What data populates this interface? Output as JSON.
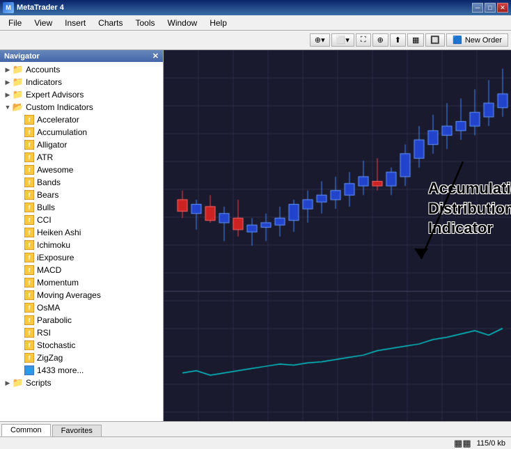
{
  "titleBar": {
    "title": "MetaTrader 4",
    "minimizeLabel": "─",
    "maximizeLabel": "□",
    "closeLabel": "✕"
  },
  "menuBar": {
    "items": [
      "File",
      "View",
      "Insert",
      "Charts",
      "Tools",
      "Window",
      "Help"
    ]
  },
  "toolbar": {
    "newOrderLabel": "New Order"
  },
  "navigator": {
    "title": "Navigator",
    "closeLabel": "✕",
    "tree": [
      {
        "id": "accounts",
        "label": "Accounts",
        "indent": 0,
        "type": "root",
        "expanded": false
      },
      {
        "id": "indicators",
        "label": "Indicators",
        "indent": 0,
        "type": "root",
        "expanded": false
      },
      {
        "id": "expert-advisors",
        "label": "Expert Advisors",
        "indent": 0,
        "type": "root",
        "expanded": false
      },
      {
        "id": "custom-indicators",
        "label": "Custom Indicators",
        "indent": 0,
        "type": "root-open",
        "expanded": true
      },
      {
        "id": "accelerator",
        "label": "Accelerator",
        "indent": 1,
        "type": "indicator"
      },
      {
        "id": "accumulation",
        "label": "Accumulation",
        "indent": 1,
        "type": "indicator"
      },
      {
        "id": "alligator",
        "label": "Alligator",
        "indent": 1,
        "type": "indicator"
      },
      {
        "id": "atr",
        "label": "ATR",
        "indent": 1,
        "type": "indicator"
      },
      {
        "id": "awesome",
        "label": "Awesome",
        "indent": 1,
        "type": "indicator"
      },
      {
        "id": "bands",
        "label": "Bands",
        "indent": 1,
        "type": "indicator"
      },
      {
        "id": "bears",
        "label": "Bears",
        "indent": 1,
        "type": "indicator"
      },
      {
        "id": "bulls",
        "label": "Bulls",
        "indent": 1,
        "type": "indicator"
      },
      {
        "id": "cci",
        "label": "CCI",
        "indent": 1,
        "type": "indicator"
      },
      {
        "id": "heiken-ashi",
        "label": "Heiken Ashi",
        "indent": 1,
        "type": "indicator"
      },
      {
        "id": "ichimoku",
        "label": "Ichimoku",
        "indent": 1,
        "type": "indicator"
      },
      {
        "id": "iexposure",
        "label": "iExposure",
        "indent": 1,
        "type": "indicator"
      },
      {
        "id": "macd",
        "label": "MACD",
        "indent": 1,
        "type": "indicator"
      },
      {
        "id": "momentum",
        "label": "Momentum",
        "indent": 1,
        "type": "indicator"
      },
      {
        "id": "moving-averages",
        "label": "Moving Averages",
        "indent": 1,
        "type": "indicator"
      },
      {
        "id": "osma",
        "label": "OsMA",
        "indent": 1,
        "type": "indicator"
      },
      {
        "id": "parabolic",
        "label": "Parabolic",
        "indent": 1,
        "type": "indicator"
      },
      {
        "id": "rsi",
        "label": "RSI",
        "indent": 1,
        "type": "indicator"
      },
      {
        "id": "stochastic",
        "label": "Stochastic",
        "indent": 1,
        "type": "indicator"
      },
      {
        "id": "zigzag",
        "label": "ZigZag",
        "indent": 1,
        "type": "indicator"
      },
      {
        "id": "more",
        "label": "1433 more...",
        "indent": 1,
        "type": "more"
      },
      {
        "id": "scripts",
        "label": "Scripts",
        "indent": 0,
        "type": "root",
        "expanded": false
      }
    ]
  },
  "annotation": {
    "line1": "Accumulation",
    "line2": "Distribution",
    "line3": "Indicator"
  },
  "tabs": [
    {
      "id": "common",
      "label": "Common",
      "active": true
    },
    {
      "id": "favorites",
      "label": "Favorites",
      "active": false
    }
  ],
  "statusBar": {
    "memory": "115/0 kb"
  }
}
